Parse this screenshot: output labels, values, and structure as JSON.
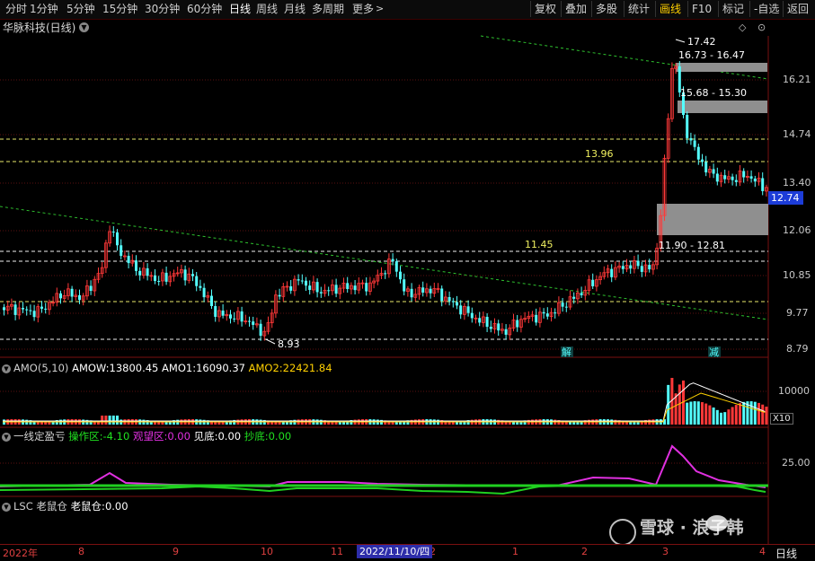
{
  "toolbar": {
    "periods": [
      "分时",
      "1分钟",
      "5分钟",
      "15分钟",
      "30分钟",
      "60分钟",
      "日线",
      "周线",
      "月线",
      "多周期",
      "更多"
    ],
    "active_period": "日线",
    "right_buttons": [
      "复权",
      "叠加",
      "多股",
      "统计",
      "画线",
      "F10",
      "标记",
      "-自选",
      "返回"
    ],
    "highlight_button": "画线"
  },
  "stock": {
    "name": "华脉科技(日线)"
  },
  "price_axis": {
    "labels": [
      "16.21",
      "14.74",
      "13.40",
      "12.06",
      "10.85",
      "9.77",
      "8.79"
    ],
    "current_price": "12.74"
  },
  "annotations": {
    "high": "17.42",
    "low": "8.93",
    "zone1": "16.73 - 16.47",
    "zone2": "15.68 - 15.30",
    "zone3": "11.90 - 12.81",
    "level_13": "13.96",
    "level_11": "11.45",
    "tag_jie": "解",
    "tag_jian": "减"
  },
  "amo_panel": {
    "name": "AMO(5,10)",
    "amow_label": "AMOW:",
    "amow_value": "13800.45",
    "amo1_label": "AMO1:",
    "amo1_value": "16090.37",
    "amo2_label": "AMO2:",
    "amo2_value": "22421.84",
    "axis_label": "10000",
    "unit_label": "X10"
  },
  "indicator_panel": {
    "name": "一线定盈亏",
    "op_label": "操作区:",
    "op_value": "-4.10",
    "watch_label": "观望区:",
    "watch_value": "0.00",
    "bottom_label": "见底:",
    "bottom_value": "0.00",
    "buy_label": "抄底:",
    "buy_value": "0.00",
    "axis_label": "25.00"
  },
  "lsc_panel": {
    "name": "LSC 老鼠仓",
    "label": "老鼠仓:",
    "value": "0.00"
  },
  "xaxis": {
    "ticks": [
      "2022年",
      "8",
      "9",
      "10",
      "11",
      "2",
      "1",
      "2",
      "3",
      "4"
    ],
    "cursor_date": "2022/11/10/四",
    "period": "日线"
  },
  "watermark": {
    "text": "雪球 · 浪子韩"
  },
  "colors": {
    "up": "#ff3838",
    "down": "#54ffff",
    "toolbar_bg": "#0b0b0b",
    "badge": "#1c3cd8",
    "accent_yellow": "#ffd000"
  },
  "icons": [
    "chevron-down-icon",
    "chevron-right-icon",
    "diamond-icon",
    "wechat-icon",
    "snowball-icon"
  ]
}
